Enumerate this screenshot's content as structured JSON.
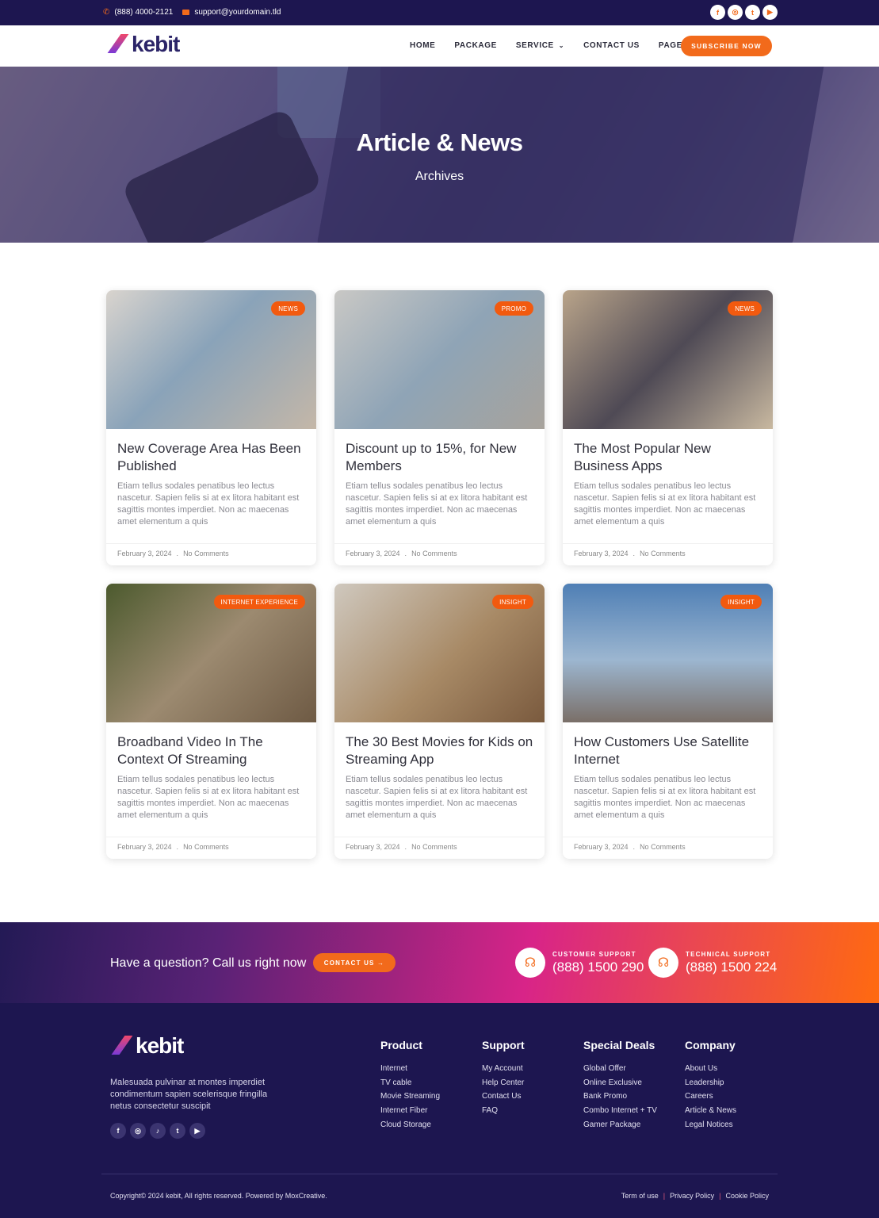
{
  "topbar": {
    "phone": "(888) 4000-2121",
    "email": "support@yourdomain.tld",
    "social": [
      "facebook-icon",
      "instagram-icon",
      "twitter-icon",
      "youtube-icon"
    ]
  },
  "nav": {
    "logo": "kebit",
    "items": [
      {
        "label": "HOME",
        "dropdown": false
      },
      {
        "label": "PACKAGE",
        "dropdown": false
      },
      {
        "label": "SERVICE",
        "dropdown": true
      },
      {
        "label": "CONTACT US",
        "dropdown": false
      },
      {
        "label": "PAGES",
        "dropdown": true
      }
    ],
    "cta": "SUBSCRIBE NOW"
  },
  "hero": {
    "title": "Article & News",
    "subtitle": "Archives"
  },
  "posts": [
    {
      "badge": "NEWS",
      "title": "New Coverage Area Has Been Published",
      "excerpt": "Etiam tellus sodales penatibus leo lectus nascetur. Sapien felis si at ex litora habitant est sagittis montes imperdiet. Non ac maecenas amet elementum a quis",
      "date": "February 3, 2024",
      "comments": "No Comments"
    },
    {
      "badge": "PROMO",
      "title": "Discount up to 15%, for New Members",
      "excerpt": "Etiam tellus sodales penatibus leo lectus nascetur. Sapien felis si at ex litora habitant est sagittis montes imperdiet. Non ac maecenas amet elementum a quis",
      "date": "February 3, 2024",
      "comments": "No Comments"
    },
    {
      "badge": "NEWS",
      "title": "The Most Popular New Business Apps",
      "excerpt": "Etiam tellus sodales penatibus leo lectus nascetur. Sapien felis si at ex litora habitant est sagittis montes imperdiet. Non ac maecenas amet elementum a quis",
      "date": "February 3, 2024",
      "comments": "No Comments"
    },
    {
      "badge": "INTERNET EXPERIENCE",
      "title": "Broadband Video In The Context Of Streaming",
      "excerpt": "Etiam tellus sodales penatibus leo lectus nascetur. Sapien felis si at ex litora habitant est sagittis montes imperdiet. Non ac maecenas amet elementum a quis",
      "date": "February 3, 2024",
      "comments": "No Comments"
    },
    {
      "badge": "INSIGHT",
      "title": "The 30 Best Movies for Kids on Streaming App",
      "excerpt": "Etiam tellus sodales penatibus leo lectus nascetur. Sapien felis si at ex litora habitant est sagittis montes imperdiet. Non ac maecenas amet elementum a quis",
      "date": "February 3, 2024",
      "comments": "No Comments"
    },
    {
      "badge": "INSIGHT",
      "title": "How Customers Use Satellite Internet",
      "excerpt": "Etiam tellus sodales penatibus leo lectus nascetur. Sapien felis si at ex litora habitant est sagittis montes imperdiet. Non ac maecenas amet elementum a quis",
      "date": "February 3, 2024",
      "comments": "No Comments"
    }
  ],
  "cta": {
    "question": "Have a question? Call us right now",
    "button": "CONTACT US →",
    "customer": {
      "label": "CUSTOMER SUPPORT",
      "number": "(888) 1500 290"
    },
    "technical": {
      "label": "TECHNICAL SUPPORT",
      "number": "(888) 1500 224"
    }
  },
  "footer": {
    "logo": "kebit",
    "description": "Malesuada pulvinar at montes imperdiet condimentum sapien scelerisque fringilla netus consectetur suscipit",
    "social": [
      "facebook-icon",
      "instagram-icon",
      "tiktok-icon",
      "twitter-icon",
      "youtube-icon"
    ],
    "columns": [
      {
        "title": "Product",
        "links": [
          "Internet",
          "TV cable",
          "Movie Streaming",
          "Internet Fiber",
          "Cloud Storage"
        ]
      },
      {
        "title": "Support",
        "links": [
          "My Account",
          "Help Center",
          "Contact Us",
          "FAQ"
        ]
      },
      {
        "title": "Special Deals",
        "links": [
          "Global Offer",
          "Online Exclusive",
          "Bank Promo",
          "Combo Internet + TV",
          "Gamer Package"
        ]
      },
      {
        "title": "Company",
        "links": [
          "About Us",
          "Leadership",
          "Careers",
          "Article & News",
          "Legal Notices"
        ]
      }
    ],
    "copyright": "Copyright© 2024 kebit, All rights reserved. Powered by MoxCreative.",
    "legal": [
      "Term of use",
      "Privacy Policy",
      "Cookie Policy"
    ]
  },
  "colors": {
    "accent": "#f26a1b",
    "navy": "#1d1650",
    "badge": "#f25a0f"
  }
}
